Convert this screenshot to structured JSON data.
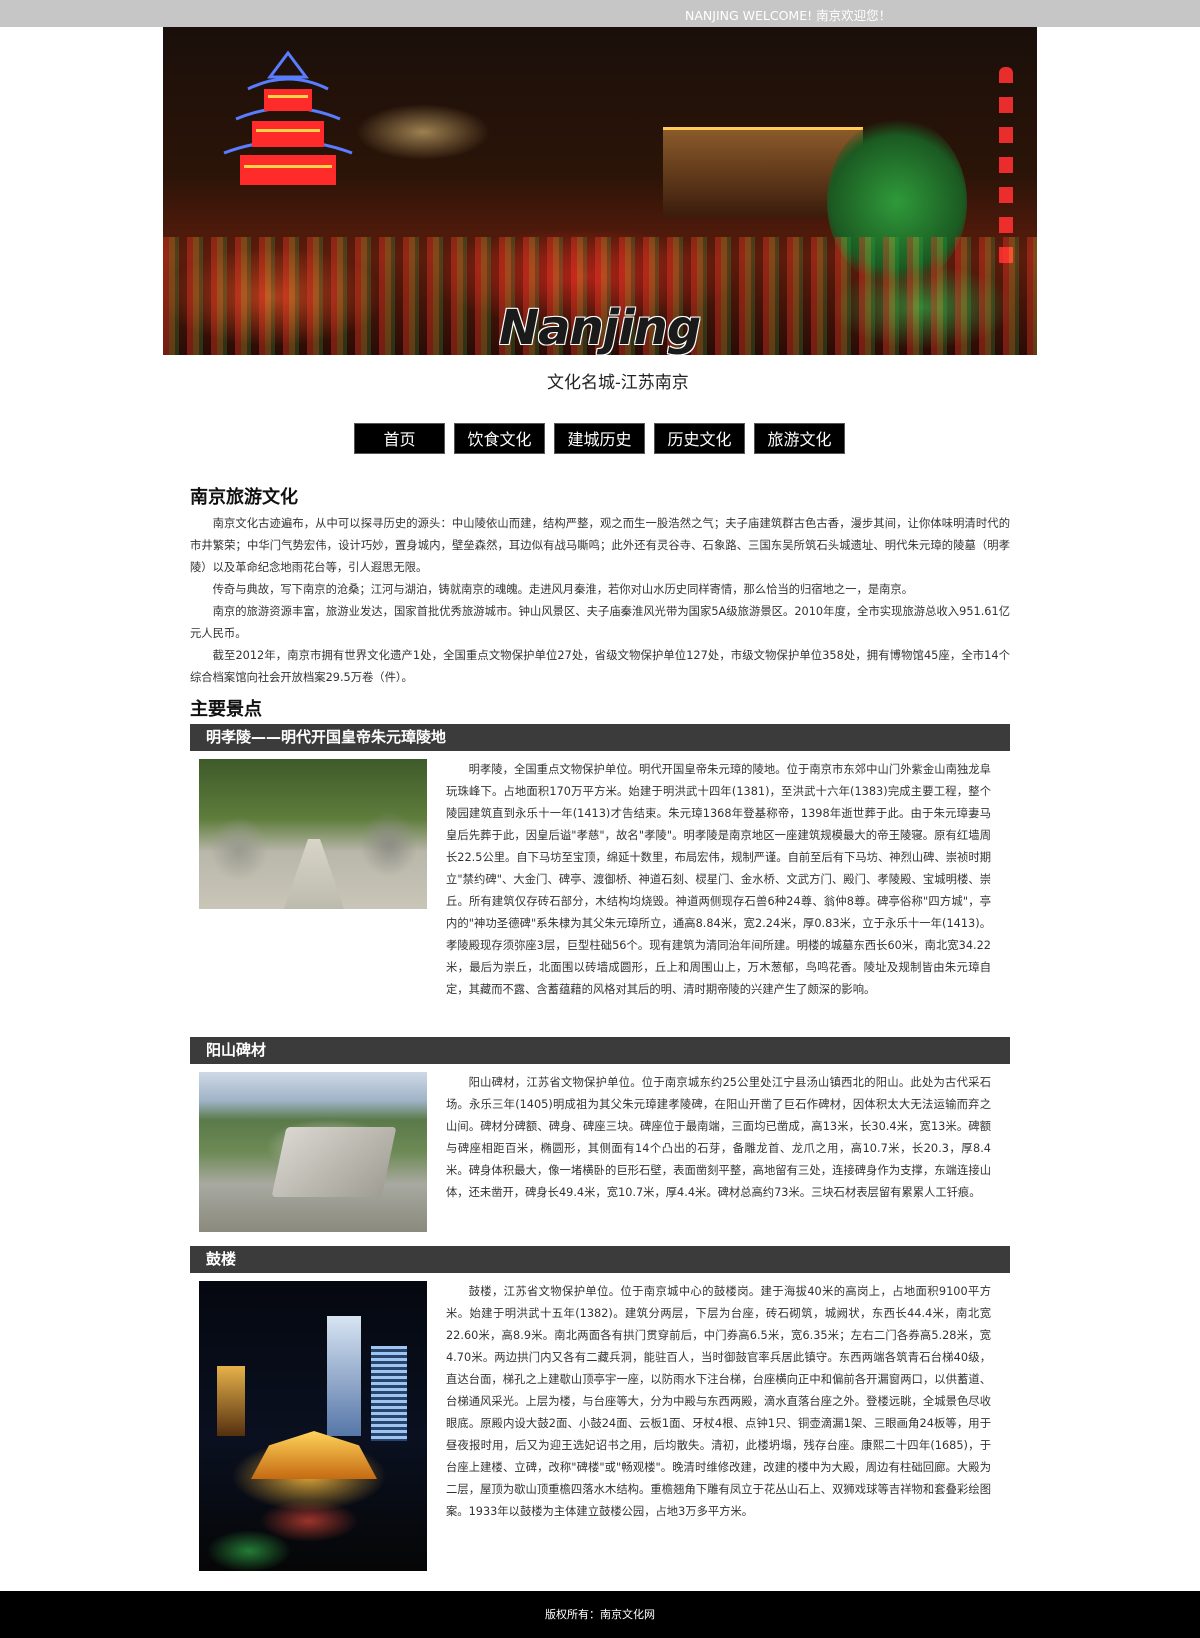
{
  "topbar": {
    "text": "NANJING WELCOME! 南京欢迎您！"
  },
  "banner": {
    "logo_word": "Nanjing",
    "logo_subtitle": "文化名城-江苏南京"
  },
  "nav": {
    "items": [
      {
        "label": "首页"
      },
      {
        "label": "饮食文化"
      },
      {
        "label": "建城历史"
      },
      {
        "label": "历史文化"
      },
      {
        "label": "旅游文化"
      }
    ]
  },
  "intro": {
    "title": "南京旅游文化",
    "paragraphs": [
      "南京文化古迹遍布，从中可以探寻历史的源头：中山陵依山而建，结构严整，观之而生一股浩然之气；夫子庙建筑群古色古香，漫步其间，让你体味明清时代的市井繁荣；中华门气势宏伟，设计巧妙，置身城内，壁垒森然，耳边似有战马嘶鸣；此外还有灵谷寺、石象路、三国东吴所筑石头城遗址、明代朱元璋的陵墓（明孝陵）以及革命纪念地雨花台等，引人遐思无限。",
      "传奇与典故，写下南京的沧桑；江河与湖泊，铸就南京的魂魄。走进风月秦淮，若你对山水历史同样寄情，那么恰当的归宿地之一，是南京。",
      "南京的旅游资源丰富，旅游业发达，国家首批优秀旅游城市。钟山风景区、夫子庙秦淮风光带为国家5A级旅游景区。2010年度，全市实现旅游总收入951.61亿元人民币。",
      "截至2012年，南京市拥有世界文化遗产1处，全国重点文物保护单位27处，省级文物保护单位127处，市级文物保护单位358处，拥有博物馆45座，全市14个综合档案馆向社会开放档案29.5万卷（件）。"
    ]
  },
  "spots": {
    "title": "主要景点",
    "items": [
      {
        "name": "明孝陵——明代开国皇帝朱元璋陵地",
        "text": "明孝陵，全国重点文物保护单位。明代开国皇帝朱元璋的陵地。位于南京市东郊中山门外紫金山南独龙阜玩珠峰下。占地面积170万平方米。始建于明洪武十四年(1381)，至洪武十六年(1383)完成主要工程，整个陵园建筑直到永乐十一年(1413)才告结束。朱元璋1368年登基称帝，1398年逝世葬于此。由于朱元璋妻马皇后先葬于此，因皇后谥\"孝慈\"，故名\"孝陵\"。明孝陵是南京地区一座建筑规模最大的帝王陵寝。原有红墙周长22.5公里。自下马坊至宝顶，绵延十数里，布局宏伟，规制严谨。自前至后有下马坊、神烈山碑、崇祯时期立\"禁约碑\"、大金门、碑亭、渡御桥、神道石刻、棂星门、金水桥、文武方门、殿门、孝陵殿、宝城明楼、崇丘。所有建筑仅存砖石部分，木结构均烧毁。神道两侧现存石兽6种24尊、翁仲8尊。碑亭俗称\"四方城\"，亭内的\"神功圣德碑\"系朱棣为其父朱元璋所立，通高8.84米，宽2.24米，厚0.83米，立于永乐十一年(1413)。孝陵殿现存须弥座3层，巨型柱础56个。现有建筑为清同治年间所建。明楼的城墓东西长60米，南北宽34.22米，最后为崇丘，北面围以砖墙成圆形，丘上和周围山上，万木葱郁，鸟鸣花香。陵址及规制皆由朱元璋自定，其藏而不露、含蓄蕴藉的风格对其后的明、清时期帝陵的兴建产生了颇深的影响。"
      },
      {
        "name": "阳山碑材",
        "text": "阳山碑材，江苏省文物保护单位。位于南京城东约25公里处江宁县汤山镇西北的阳山。此处为古代采石场。永乐三年(1405)明成祖为其父朱元璋建孝陵碑，在阳山开凿了巨石作碑材，因体积太大无法运输而弃之山间。碑材分碑额、碑身、碑座三块。碑座位于最南端，三面均已凿成，高13米，长30.4米，宽13米。碑额与碑座相距百米，椭圆形，其侧面有14个凸出的石芽，备雕龙首、龙爪之用，高10.7米，长20.3，厚8.4米。碑身体积最大，像一堵横卧的巨形石壁，表面凿刻平整，高地留有三处，连接碑身作为支撑，东端连接山体，还未凿开，碑身长49.4米，宽10.7米，厚4.4米。碑材总高约73米。三块石材表层留有累累人工钎痕。"
      },
      {
        "name": "鼓楼",
        "text": "鼓楼，江苏省文物保护单位。位于南京城中心的鼓楼岗。建于海拔40米的高岗上，占地面积9100平方米。始建于明洪武十五年(1382)。建筑分两层，下层为台座，砖石砌筑，城阙状，东西长44.4米，南北宽22.60米，高8.9米。南北两面各有拱门贯穿前后，中门券高6.5米，宽6.35米；左右二门各券高5.28米，宽4.70米。两边拱门内又各有二藏兵洞，能驻百人，当时御鼓官率兵居此镇守。东西两端各筑青石台梯40级，直达台面，梯孔之上建歇山顶亭宇一座，以防雨水下注台梯，台座横向正中和偏前各开漏窗两口，以供蓄道、台梯通风采光。上层为楼，与台座等大，分为中殿与东西两殿，滴水直落台座之外。登楼远眺，全城景色尽收眼底。原殿内设大鼓2面、小鼓24面、云板1面、牙杖4根、点钟1只、铜壶滴漏1架、三眼画角24板等，用于昼夜报时用，后又为迎王选妃诏书之用，后均散失。清初，此楼坍塌，残存台座。康熙二十四年(1685)，于台座上建楼、立碑，改称\"碑楼\"或\"畅观楼\"。晚清时维修改建，改建的楼中为大殿，周边有柱础回廊。大殿为二层，屋顶为歇山顶重檐四落水木结构。重檐翘角下雕有凤立于花丛山石上、双狮戏球等吉祥物和套叠彩绘图案。1933年以鼓楼为主体建立鼓楼公园，占地3万多平方米。"
      }
    ]
  },
  "footer": {
    "text": "版权所有：南京文化网"
  }
}
